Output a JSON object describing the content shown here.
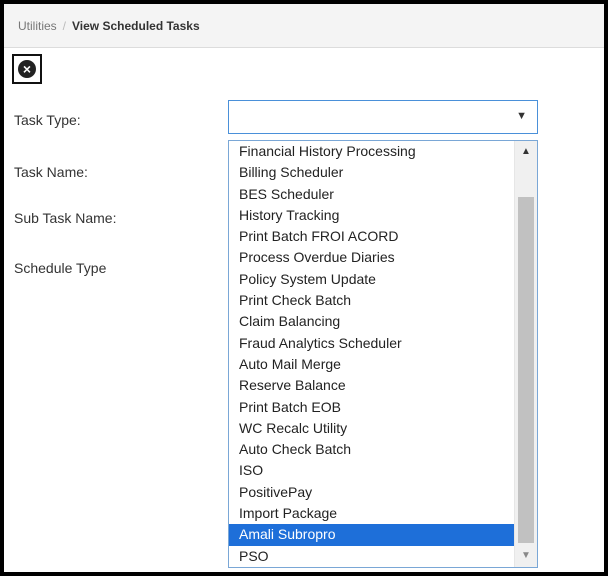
{
  "breadcrumb": {
    "root": "Utilities",
    "separator": "/",
    "current": "View Scheduled Tasks"
  },
  "close_icon": "close-circle-icon",
  "form": {
    "task_type_label": "Task Type:",
    "task_name_label": "Task Name:",
    "sub_task_name_label": "Sub Task Name:",
    "schedule_type_label": "Schedule Type",
    "task_type_value": ""
  },
  "dropdown": {
    "options": [
      "Financial History Processing",
      "Billing Scheduler",
      "BES Scheduler",
      "History Tracking",
      "Print Batch FROI ACORD",
      "Process Overdue Diaries",
      "Policy System Update",
      "Print Check Batch",
      "Claim Balancing",
      "Fraud Analytics Scheduler",
      "Auto Mail Merge",
      "Reserve Balance",
      "Print Batch EOB",
      "WC Recalc Utility",
      "Auto Check Batch",
      "ISO",
      "PositivePay",
      "Import Package",
      "Amali Subropro",
      "PSO"
    ],
    "selected_index": 18,
    "selected_color": "#1e6fd9"
  }
}
